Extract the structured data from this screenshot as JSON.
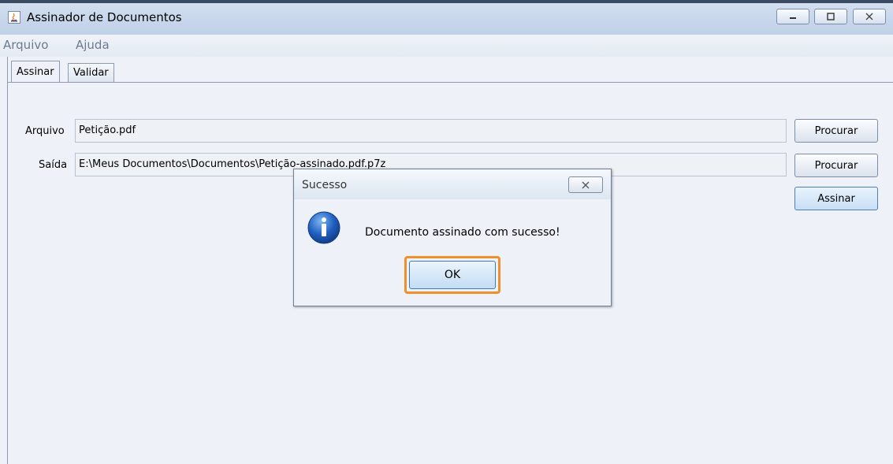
{
  "window": {
    "title": "Assinador de Documentos"
  },
  "menu": {
    "items": [
      "Arquivo",
      "Ajuda"
    ]
  },
  "tabs": [
    {
      "label": "Assinar"
    },
    {
      "label": "Validar"
    }
  ],
  "form": {
    "arquivo_label": "Arquivo",
    "arquivo_value": "Petição.pdf",
    "saida_label": "Saída",
    "saida_value": "E:\\Meus Documentos\\Documentos\\Petição-assinado.pdf.p7z",
    "procurar_label": "Procurar",
    "assinar_label": "Assinar"
  },
  "dialog": {
    "title": "Sucesso",
    "message": "Documento assinado com sucesso!",
    "ok_label": "OK",
    "icon": "info-icon"
  },
  "colors": {
    "highlight": "#f0902a",
    "titlebar": "#cad8ec",
    "accent": "#3e7bc1"
  }
}
